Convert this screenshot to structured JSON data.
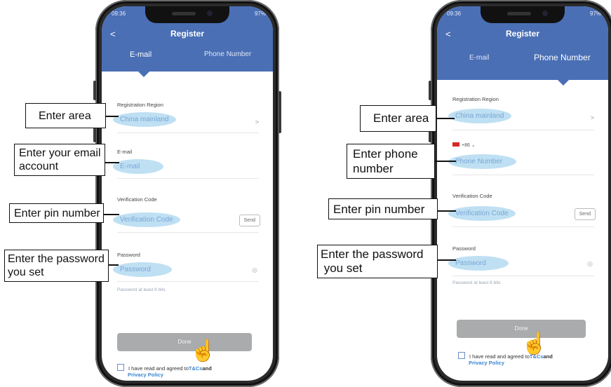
{
  "left_phone": {
    "status": {
      "time": "09:36",
      "battery": "97%"
    },
    "header": {
      "back": "<",
      "title": "Register"
    },
    "tabs": [
      "E-mail",
      "Phone Number"
    ],
    "region_label": "Registration Region",
    "region_value": "China mainland",
    "region_chevron": ">",
    "email_label": "E-mail",
    "email_placeholder": "E-mail",
    "code_label": "Verification Code",
    "code_placeholder": "Verification Code",
    "send_label": "Send",
    "password_label": "Password",
    "password_placeholder": "Password",
    "password_hint": "Password at least 6 bits",
    "done_label": "Done",
    "agree_text": "I have read and agreed to",
    "tcs": "T&Cs",
    "and": "and",
    "privacy": "Privacy Policy"
  },
  "right_phone": {
    "status": {
      "time": "09:36",
      "battery": "97%"
    },
    "header": {
      "back": "<",
      "title": "Register"
    },
    "tabs": [
      "E-mail",
      "Phone Number"
    ],
    "region_label": "Registration Region",
    "region_value": "China mainland",
    "region_chevron": ">",
    "country_code": "+86",
    "phone_placeholder": "Phone Number",
    "code_label": "Verification Code",
    "code_placeholder": "Verification Code",
    "send_label": "Send",
    "password_label": "Password",
    "password_placeholder": "Password",
    "password_hint": "Password at least 6 bits",
    "done_label": "Done",
    "agree_text": "I have read and agreed to",
    "tcs": "T&Cs",
    "and": "and",
    "privacy": "Privacy Policy"
  },
  "callouts_left": {
    "area": "Enter area",
    "email_line1": "Enter your email",
    "email_line2": "account",
    "pin": "Enter pin number",
    "pw_line1": "Enter the password",
    "pw_line2": "you set"
  },
  "callouts_right": {
    "area": "Enter area",
    "phone_line1": "Enter phone",
    "phone_line2": "number",
    "pin": "Enter pin number",
    "pw_line1": "Enter the password",
    "pw_line2": " you set"
  },
  "colors": {
    "header_blue": "#4a6fb5",
    "field_highlight": "#bfe0f3",
    "link_blue": "#3c86d1",
    "done_gray": "#a9abad"
  }
}
